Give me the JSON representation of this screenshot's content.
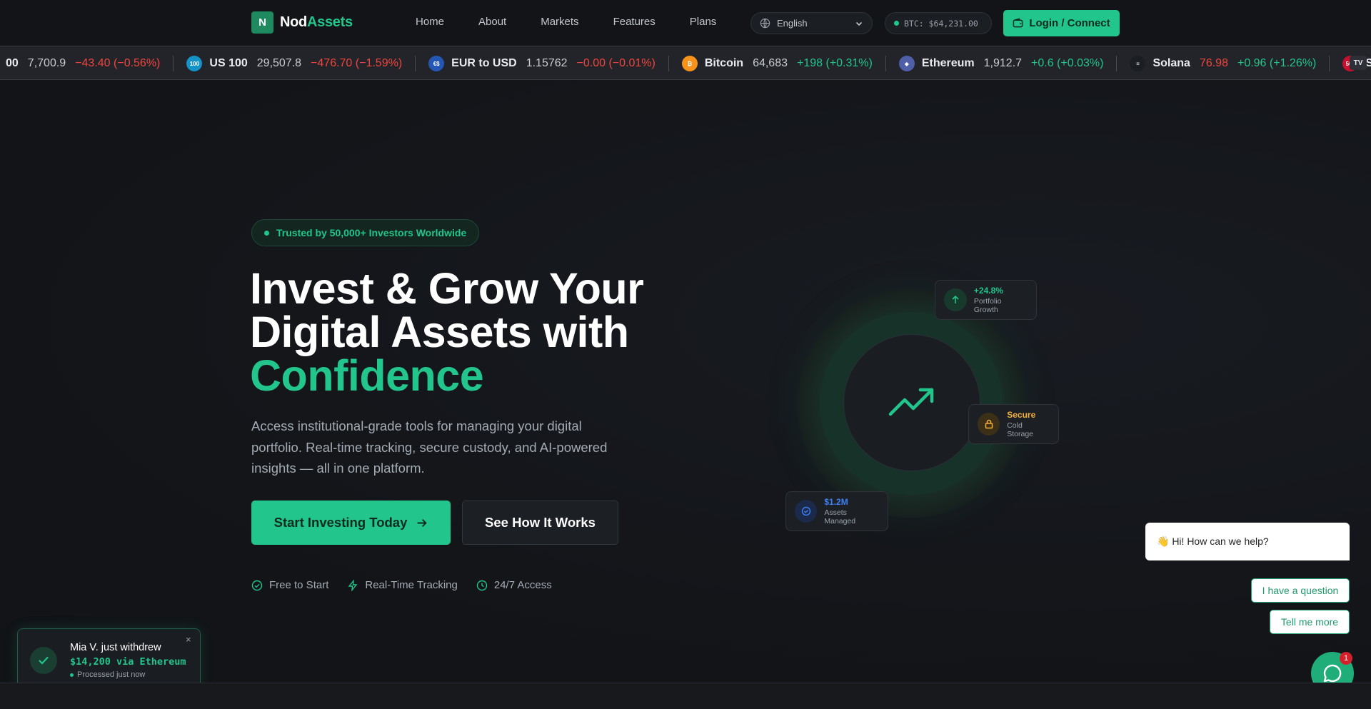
{
  "brand": {
    "mark": "N",
    "name_a": "Nod",
    "name_b": "Assets"
  },
  "nav": {
    "links": [
      "Home",
      "About",
      "Markets",
      "Features",
      "Plans"
    ]
  },
  "language": {
    "selected": "English"
  },
  "btc_pill": "BTC: $64,231.00",
  "login_label": "Login / Connect",
  "ticker": [
    {
      "name": "00",
      "price": "7,700.9",
      "change": "−43.40 (−0.56%)",
      "dir": "neg",
      "icon": "",
      "color": ""
    },
    {
      "name": "US 100",
      "price": "29,507.8",
      "change": "−476.70 (−1.59%)",
      "dir": "neg",
      "icon": "100",
      "color": "#1593c7"
    },
    {
      "name": "EUR to USD",
      "price": "1.15762",
      "change": "−0.00 (−0.01%)",
      "dir": "neg",
      "icon": "€$",
      "color": "#2456b3"
    },
    {
      "name": "Bitcoin",
      "price": "64,683",
      "change": "+198 (+0.31%)",
      "dir": "pos",
      "icon": "₿",
      "color": "#f7931a"
    },
    {
      "name": "Ethereum",
      "price": "1,912.7",
      "change": "+0.6 (+0.03%)",
      "dir": "pos",
      "icon": "◆",
      "color": "#4f5fa8"
    },
    {
      "name": "Solana",
      "price": "76.98",
      "change": "+0.96 (+1.26%)",
      "dir": "pos",
      "icon": "≡",
      "color": "#1b1e23",
      "price_color": "#f0453f"
    },
    {
      "name": "S&",
      "price": "",
      "change": "",
      "dir": "",
      "icon": "500",
      "color": "#c8102e"
    }
  ],
  "ticker_badge": "TV",
  "hero": {
    "badge": "Trusted by 50,000+ Investors Worldwide",
    "title_line1": "Invest & Grow Your",
    "title_line2": "Digital Assets with",
    "title_accent": "Confidence",
    "lead": "Access institutional-grade tools for managing your digital portfolio. Real-time tracking, secure custody, and AI-powered insights — all in one platform.",
    "cta_primary": "Start Investing Today",
    "cta_secondary": "See How It Works",
    "features": [
      "Free to Start",
      "Real-Time Tracking",
      "24/7 Access"
    ]
  },
  "stats": {
    "growth": {
      "value": "+24.8%",
      "label": "Portfolio Growth"
    },
    "secure": {
      "value": "Secure",
      "label": "Cold Storage"
    },
    "assets": {
      "value": "$1.2M",
      "label": "Assets Managed"
    }
  },
  "chat": {
    "greeting": "👋 Hi! How can we help?",
    "option1": "I have a question",
    "option2": "Tell me more",
    "unread": "1"
  },
  "toast": {
    "title": "Mia V. just withdrew",
    "amount": "$14,200 via Ethereum",
    "sub": "Processed just now",
    "close": "×"
  },
  "colors": {
    "accent": "#22c58b",
    "bg": "#121418",
    "negative": "#f0453f",
    "warning": "#f5b13d",
    "info": "#3b82f6"
  }
}
